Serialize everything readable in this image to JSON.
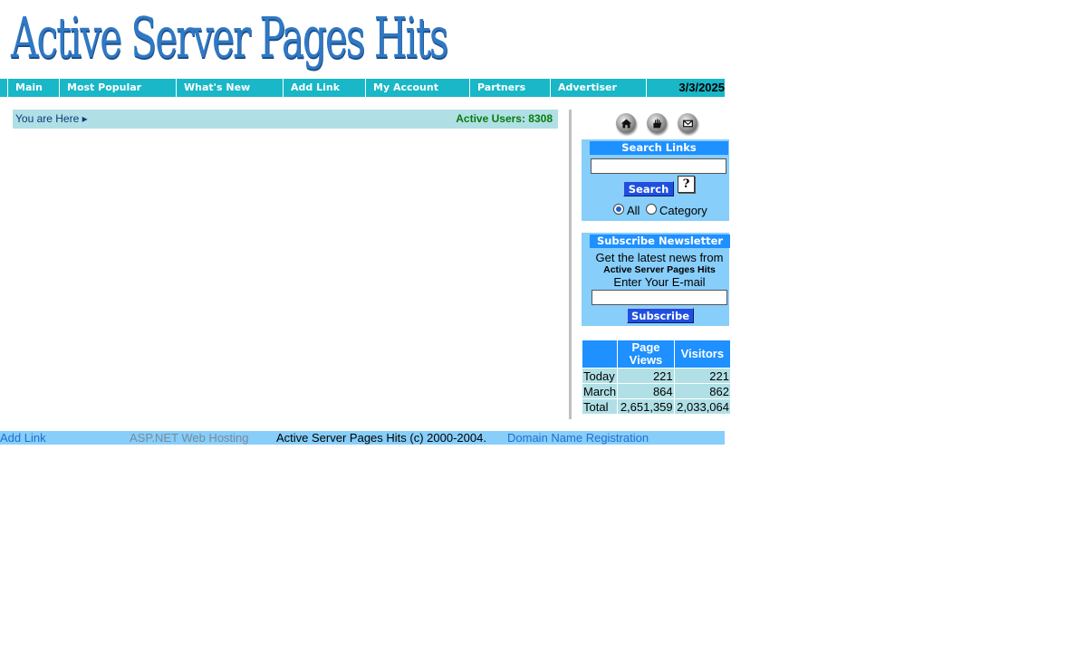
{
  "site": {
    "title": "Active Server Pages Hits"
  },
  "nav": {
    "items": [
      "Main",
      "Most Popular",
      "What's New",
      "Add Link",
      "My Account",
      "Partners",
      "Advertiser"
    ],
    "date": "3/3/2025"
  },
  "breadcrumb": {
    "label": "You are Here ▸",
    "active_users": "Active Users: 8308"
  },
  "icons": [
    "home-icon",
    "guestbook-icon",
    "email-icon"
  ],
  "search": {
    "title": "Search Links",
    "button": "Search",
    "help": "?",
    "value": "",
    "options": [
      "All",
      "Category"
    ],
    "selected": "All"
  },
  "newsletter": {
    "title": "Subscribe Newsletter",
    "line1": "Get the latest news from",
    "line2": "Active Server Pages Hits",
    "line3": "Enter Your E-mail",
    "value": "",
    "button": "Subscribe"
  },
  "stats": {
    "headers": [
      "",
      "Page Views",
      "Visitors"
    ],
    "rows": [
      {
        "label": "Today",
        "page_views": "221",
        "visitors": "221"
      },
      {
        "label": "March",
        "page_views": "864",
        "visitors": "862"
      },
      {
        "label": "Total",
        "page_views": "2,651,359",
        "visitors": "2,033,064"
      }
    ]
  },
  "footer": {
    "add_link": "Add Link",
    "hosting": "ASP.NET Web Hosting",
    "copyright": "Active Server Pages Hits (c) 2000-2004.",
    "domain": "Domain Name Registration"
  },
  "colors": {
    "nav": "#19b7c7",
    "box": "#87cefa",
    "box_title": "#1e90ff",
    "row": "#b0e0e6"
  }
}
